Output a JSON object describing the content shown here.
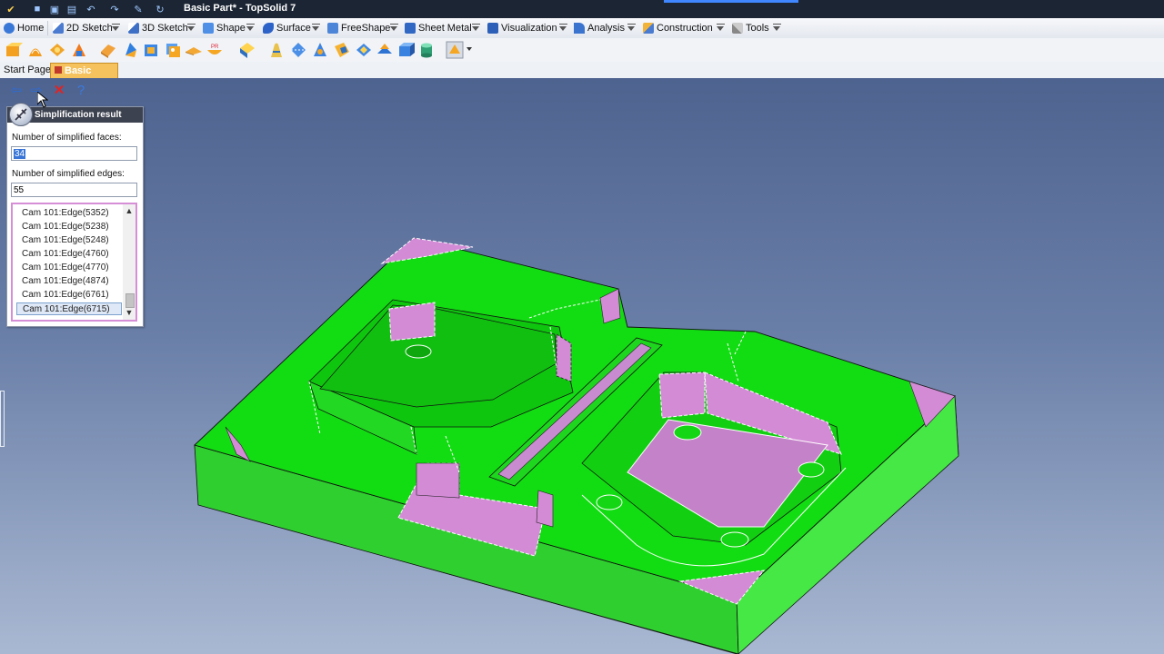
{
  "window": {
    "title": "Basic Part* - TopSolid 7"
  },
  "menu": {
    "items": [
      "Home",
      "2D Sketch",
      "3D Sketch",
      "Shape",
      "Surface",
      "FreeShape",
      "Sheet Metal",
      "Visualization",
      "Analysis",
      "Construction",
      "Tools"
    ]
  },
  "tabs": [
    "Start Page",
    "Basic Part*"
  ],
  "panel": {
    "title": "Simplification result",
    "faces_label": "Number of simplified faces:",
    "faces_value": "34",
    "edges_label": "Number of simplified edges:",
    "edges_value": "55",
    "list_items": [
      "Cam 101:Edge(5352)",
      "Cam 101:Edge(5238)",
      "Cam 101:Edge(5248)",
      "Cam 101:Edge(4760)",
      "Cam 101:Edge(4770)",
      "Cam 101:Edge(4874)",
      "Cam 101:Edge(6761)",
      "Cam 101:Edge(6715)"
    ],
    "selected_item": "Cam 101:Edge(6715)"
  },
  "colors": {
    "part_green": "#16e216",
    "face_highlight": "#d38bd6",
    "tab_active": "#f6c25e",
    "viewport_top": "#4e638f",
    "viewport_bottom": "#a9b8d2"
  }
}
